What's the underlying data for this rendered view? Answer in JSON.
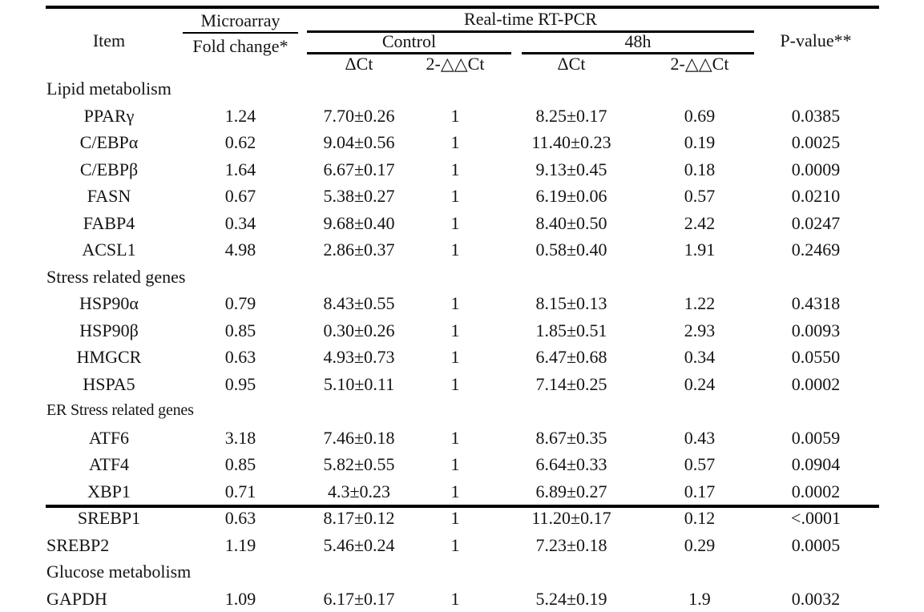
{
  "table": {
    "header": {
      "item": "Item",
      "microarray": "Microarray",
      "fold_change": "Fold  change*",
      "rtpcr": "Real-time  RT-PCR",
      "control": "Control",
      "treated": "48h",
      "dct_control": "ΔCt",
      "ddct_control": "2-△△Ct",
      "dct_48h": "ΔCt",
      "ddct_48h": "2-△△Ct",
      "p_value": "P-value**"
    },
    "columns": [
      "Item",
      "Fold  change*",
      "ΔCt",
      "2-△△Ct",
      "ΔCt",
      "2-△△Ct",
      "P-value**"
    ],
    "rows": [
      {
        "kind": "section",
        "item": "Lipid metabolism",
        "fold": "",
        "dct_c": "",
        "ddct_c": "",
        "dct_48": "",
        "ddct_48": "",
        "p": ""
      },
      {
        "kind": "gene",
        "item": "PPARγ",
        "fold": "1.24",
        "dct_c": "7.70±0.26",
        "ddct_c": "1",
        "dct_48": "8.25±0.17",
        "ddct_48": "0.69",
        "p": "0.0385"
      },
      {
        "kind": "gene",
        "item": "C/EBPα",
        "fold": "0.62",
        "dct_c": "9.04±0.56",
        "ddct_c": "1",
        "dct_48": "11.40±0.23",
        "ddct_48": "0.19",
        "p": "0.0025"
      },
      {
        "kind": "gene",
        "item": "C/EBPβ",
        "fold": "1.64",
        "dct_c": "6.67±0.17",
        "ddct_c": "1",
        "dct_48": "9.13±0.45",
        "ddct_48": "0.18",
        "p": "0.0009"
      },
      {
        "kind": "gene",
        "item": "FASN",
        "fold": "0.67",
        "dct_c": "5.38±0.27",
        "ddct_c": "1",
        "dct_48": "6.19±0.06",
        "ddct_48": "0.57",
        "p": "0.0210"
      },
      {
        "kind": "gene",
        "item": "FABP4",
        "fold": "0.34",
        "dct_c": "9.68±0.40",
        "ddct_c": "1",
        "dct_48": "8.40±0.50",
        "ddct_48": "2.42",
        "p": "0.0247"
      },
      {
        "kind": "gene",
        "item": "ACSL1",
        "fold": "4.98",
        "dct_c": "2.86±0.37",
        "ddct_c": "1",
        "dct_48": "0.58±0.40",
        "ddct_48": "1.91",
        "p": "0.2469"
      },
      {
        "kind": "section",
        "item": "Stress related genes",
        "fold": "",
        "dct_c": "",
        "ddct_c": "",
        "dct_48": "",
        "ddct_48": "",
        "p": ""
      },
      {
        "kind": "gene",
        "item": "HSP90α",
        "fold": "0.79",
        "dct_c": "8.43±0.55",
        "ddct_c": "1",
        "dct_48": "8.15±0.13",
        "ddct_48": "1.22",
        "p": "0.4318"
      },
      {
        "kind": "gene",
        "item": "HSP90β",
        "fold": "0.85",
        "dct_c": "0.30±0.26",
        "ddct_c": "1",
        "dct_48": "1.85±0.51",
        "ddct_48": "2.93",
        "p": "0.0093"
      },
      {
        "kind": "gene",
        "item": "HMGCR",
        "fold": "0.63",
        "dct_c": "4.93±0.73",
        "ddct_c": "1",
        "dct_48": "6.47±0.68",
        "ddct_48": "0.34",
        "p": "0.0550"
      },
      {
        "kind": "gene",
        "item": "HSPA5",
        "fold": "0.95",
        "dct_c": "5.10±0.11",
        "ddct_c": "1",
        "dct_48": "7.14±0.25",
        "ddct_48": "0.24",
        "p": "0.0002"
      },
      {
        "kind": "section-condensed",
        "item": "ER Stress related genes",
        "fold": "",
        "dct_c": "",
        "ddct_c": "",
        "dct_48": "",
        "ddct_48": "",
        "p": ""
      },
      {
        "kind": "gene",
        "item": "ATF6",
        "fold": "3.18",
        "dct_c": "7.46±0.18",
        "ddct_c": "1",
        "dct_48": "8.67±0.35",
        "ddct_48": "0.43",
        "p": "0.0059"
      },
      {
        "kind": "gene",
        "item": "ATF4",
        "fold": "0.85",
        "dct_c": "5.82±0.55",
        "ddct_c": "1",
        "dct_48": "6.64±0.33",
        "ddct_48": "0.57",
        "p": "0.0904"
      },
      {
        "kind": "gene",
        "item": "XBP1",
        "fold": "0.71",
        "dct_c": "4.3±0.23",
        "ddct_c": "1",
        "dct_48": "6.89±0.27",
        "ddct_48": "0.17",
        "p": "0.0002"
      },
      {
        "kind": "gene",
        "item": "SREBP1",
        "fold": "0.63",
        "dct_c": "8.17±0.12",
        "ddct_c": "1",
        "dct_48": "11.20±0.17",
        "ddct_48": "0.12",
        "p": "<.0001"
      },
      {
        "kind": "flush",
        "item": "SREBP2",
        "fold": "1.19",
        "dct_c": "5.46±0.24",
        "ddct_c": "1",
        "dct_48": "7.23±0.18",
        "ddct_48": "0.29",
        "p": "0.0005"
      },
      {
        "kind": "section",
        "item": "Glucose metabolism",
        "fold": "",
        "dct_c": "",
        "ddct_c": "",
        "dct_48": "",
        "ddct_48": "",
        "p": ""
      },
      {
        "kind": "flush",
        "item": "GAPDH",
        "fold": "1.09",
        "dct_c": "6.17±0.17",
        "ddct_c": "1",
        "dct_48": "5.24±0.19",
        "ddct_48": "1.9",
        "p": "0.0032"
      }
    ]
  }
}
